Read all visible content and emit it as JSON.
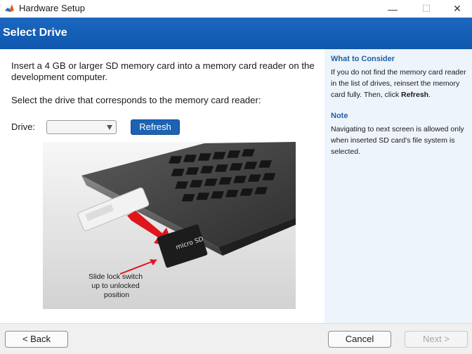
{
  "window": {
    "title": "Hardware Setup",
    "minimize_glyph": "—",
    "maximize_glyph": "☐",
    "close_glyph": "✕"
  },
  "header": {
    "title": "Select Drive"
  },
  "main": {
    "instruction_1": "Insert a 4 GB or larger SD memory card into a memory card reader on the development computer.",
    "instruction_2": "Select the drive that corresponds to the memory card reader:",
    "drive_label": "Drive:",
    "drive_value": "",
    "refresh_label": "Refresh",
    "photo_caption": [
      "Slide lock switch",
      "up to unlocked",
      "position"
    ],
    "sd_card_text": "micro SD"
  },
  "side": {
    "consider_heading": "What to Consider",
    "consider_text_1": "If you do not find the memory card reader in the list of drives, reinsert the memory card fully. Then, click ",
    "consider_text_bold": "Refresh",
    "consider_text_2": ".",
    "note_heading": "Note",
    "note_text": "Navigating to next screen is allowed only when inserted SD card's file system is selected."
  },
  "footer": {
    "back_label": "< Back",
    "cancel_label": "Cancel",
    "next_label": "Next >"
  },
  "colors": {
    "header_blue": "#1565c0",
    "refresh_blue": "#1d62b3",
    "side_panel_bg": "#eef4fb",
    "side_heading": "#1f5fa7",
    "arrow_red": "#e0141b"
  }
}
